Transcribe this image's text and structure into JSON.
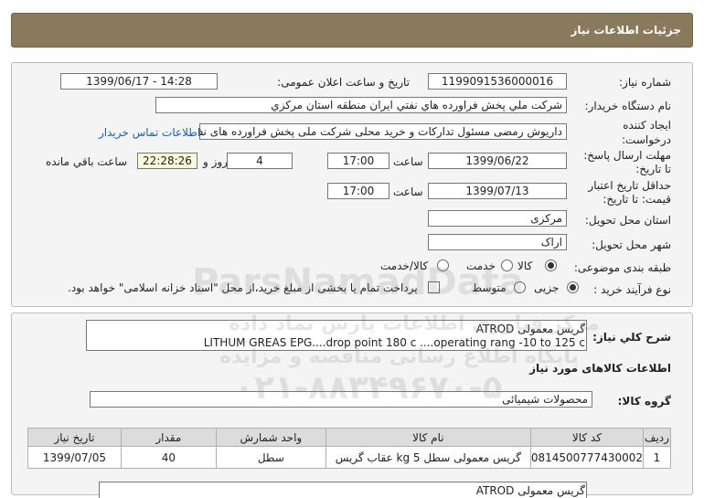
{
  "title": "جزئیات اطلاعات نیاز",
  "need_number": {
    "label": "شماره نیاز:",
    "value": "1199091536000016"
  },
  "announce": {
    "label": "تاریخ و ساعت اعلان عمومی:",
    "value": "1399/06/17 - 14:28"
  },
  "buyer": {
    "label": "نام دستگاه خریدار:",
    "value": "شرکت ملي پخش فراورده هاي نفتي ايران منطقه استان مرکزي"
  },
  "creator": {
    "label1": "ایجاد کننده",
    "label2": "درخواست:",
    "value": "داریوش رمضی مسئول تدارکات و خرید محلی شرکت ملی پخش فراورده های نف",
    "contact_link": "اطلاعات تماس خریدار"
  },
  "deadline": {
    "label1": "مهلت ارسال پاسخ:",
    "label2": "تا تاریخ:",
    "date": "1399/06/22",
    "time_label": "ساعت",
    "time": "17:00",
    "days": "4",
    "days_label": "روز و",
    "countdown": "22:28:26",
    "remaining_label": "ساعت باقي مانده"
  },
  "validity": {
    "label1": "حداقل تاریخ اعتبار",
    "label2": "قیمت: تا تاریخ:",
    "date": "1399/07/13",
    "time_label": "ساعت",
    "time": "17:00"
  },
  "province": {
    "label": "استان محل تحویل:",
    "value": "مرکزی"
  },
  "city": {
    "label": "شهر محل تحویل:",
    "value": "اراک"
  },
  "category": {
    "label": "طبقه بندی موضوعی:",
    "options": [
      "کالا",
      "خدمت",
      "کالا/خدمت"
    ]
  },
  "process": {
    "label": "نوع فرآیند خرید :",
    "options": [
      "جزیی",
      "متوسط"
    ],
    "note": "پرداخت تمام یا بخشی از مبلغ خرید،از محل \"اسناد خزانه اسلامی\" خواهد بود."
  },
  "summary": {
    "label": "شرح کلي نياز:",
    "line1": "گریس  معمولی ATROD",
    "line2": "LITHUM GREAS EPG....drop  point  180  c ....operating  rang  -10  to 125 c"
  },
  "goods_heading": "اطلاعات کالاهای مورد نیاز",
  "goods_group": {
    "label": "گروه کالا:",
    "value": "محصولات شیمیائی"
  },
  "table": {
    "headers": [
      "ردیف",
      "کد کالا",
      "نام کالا",
      "واحد شمارش",
      "مقدار",
      "تاریخ نیاز"
    ],
    "rows": [
      [
        "1",
        "0814500777430002",
        "گریس معمولی سطل 5 kg عقاب گریس",
        "سطل",
        "40",
        "1399/07/05"
      ]
    ]
  },
  "bottom_desc": "گریس  معمولی ATROD",
  "watermark": {
    "brand": "ParsNamadData",
    "line1": "مرکز فناوری اطلاعات پارس نماد داده",
    "line2": "پایگاه اطلاع رسانی مناقصه و مزایده",
    "phone": "۰۲۱-۸۸۳۴۹۶۷۰-۵"
  }
}
